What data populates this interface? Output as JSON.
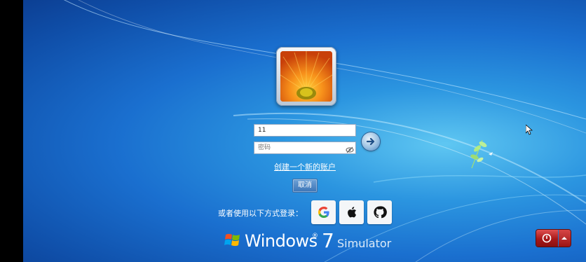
{
  "login": {
    "username_value": "11",
    "password_placeholder": "密码",
    "create_account_label": "创建一个新的账户",
    "cancel_label": "取消"
  },
  "alt_login": {
    "label": "或者使用以下方式登录：",
    "providers": [
      {
        "name": "Google",
        "icon": "google-icon"
      },
      {
        "name": "Apple",
        "icon": "apple-icon"
      },
      {
        "name": "GitHub",
        "icon": "github-icon"
      }
    ]
  },
  "brand": {
    "word": "Windows",
    "reg": "®",
    "version": "7",
    "suffix": "Simulator"
  },
  "colors": {
    "bg_light": "#5fc7f2",
    "bg_dark": "#0c3f93",
    "power_red": "#b21c1c",
    "button_blue": "#3b74b6"
  }
}
